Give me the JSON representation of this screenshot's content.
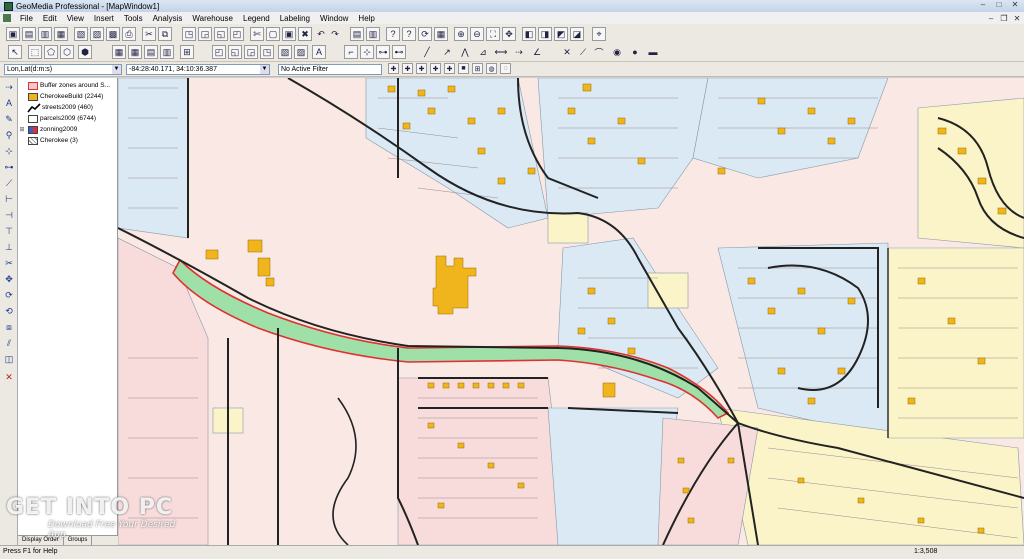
{
  "window": {
    "title": "GeoMedia Professional - [MapWindow1]",
    "min": "–",
    "max": "□",
    "close": "✕"
  },
  "menu": [
    "File",
    "Edit",
    "View",
    "Insert",
    "Tools",
    "Analysis",
    "Warehouse",
    "Legend",
    "Labeling",
    "Window",
    "Help"
  ],
  "mdi": {
    "min": "–",
    "restore": "❐",
    "close": "✕"
  },
  "combos": {
    "coord_system": "Lon,Lat(d:m:s)",
    "coordinates": "-84:28:40.171, 34:10:36.387",
    "filter": "No Active Filter"
  },
  "legend": {
    "entries": [
      {
        "label": "Buffer zones around S...",
        "swatch": "#f4c8c8"
      },
      {
        "label": "CherokeeBuild (2244)",
        "swatch": "#f0b41c"
      },
      {
        "label": "streets2009 (460)",
        "swatch": "line"
      },
      {
        "label": "parcels2009 (6744)",
        "swatch": "#ffffff"
      },
      {
        "label": "zonning2009",
        "swatch": "zoning"
      },
      {
        "label": "Cherokee (3)",
        "swatch": "pattern"
      }
    ],
    "tabs": [
      "Display Order",
      "Groups"
    ]
  },
  "status": {
    "help": "Press F1 for Help",
    "scale": "1:3,508"
  },
  "watermark": {
    "brand": "GET INTO PC",
    "tagline": "Download Free Your Desired App"
  },
  "colors": {
    "map_bg": "#f9e8e4",
    "zone_blue": "#dbe9f5",
    "zone_yellow": "#fbf4c8",
    "zone_pink": "#f8dcdc",
    "building": "#f0b41c",
    "buffer_fill": "#9fe0a8",
    "buffer_outline": "#e03030",
    "street": "#222222"
  }
}
